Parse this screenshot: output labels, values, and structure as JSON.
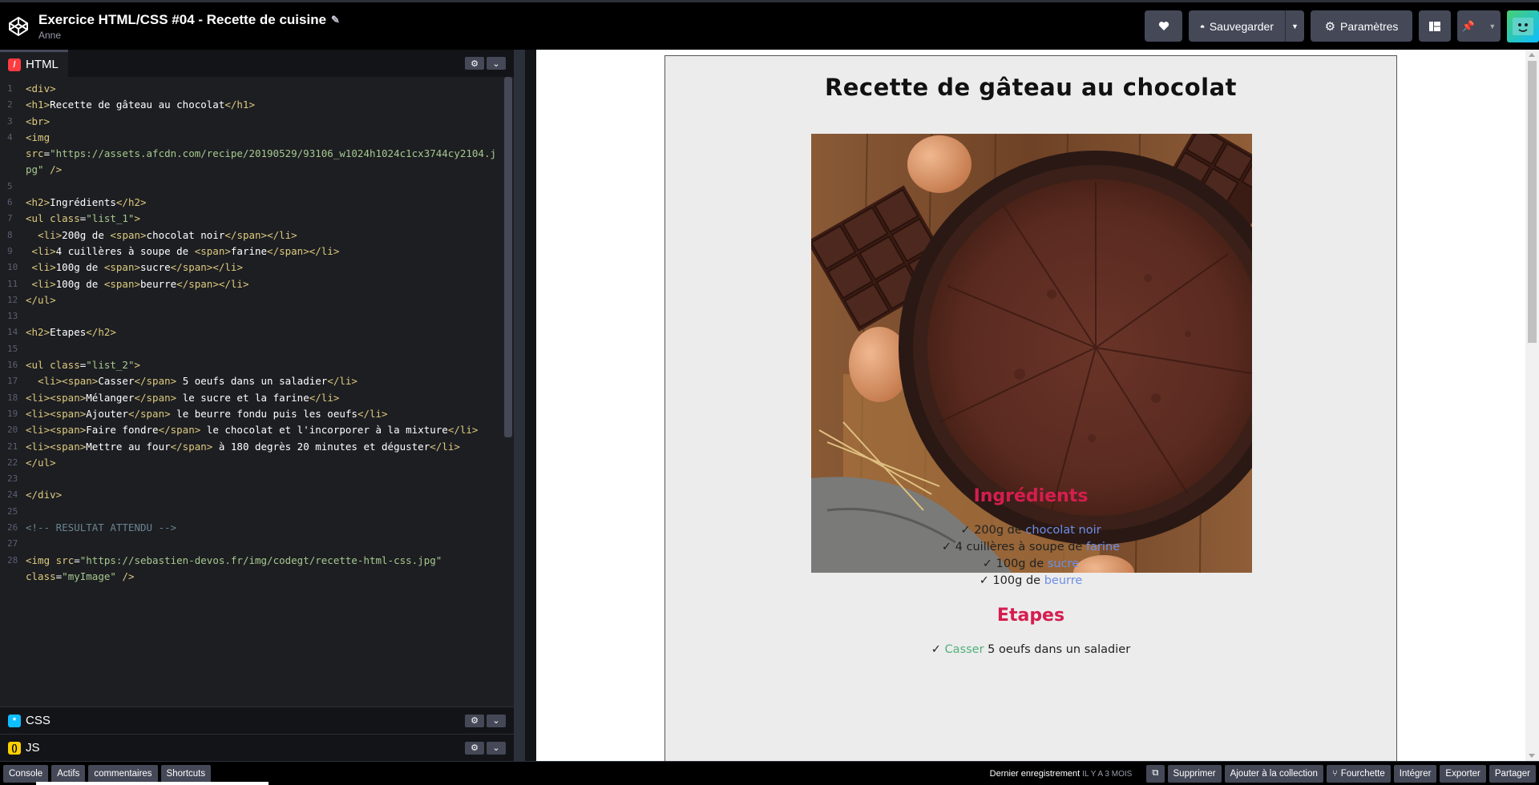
{
  "header": {
    "title": "Exercice HTML/CSS #04 - Recette de cuisine",
    "author": "Anne",
    "save_label": "Sauvegarder",
    "settings_label": "Paramètres"
  },
  "editor": {
    "html_tab": "HTML",
    "css_tab": "CSS",
    "js_tab": "JS",
    "line_numbers": [
      "1",
      "2",
      "3",
      "4",
      "",
      "",
      "5",
      "6",
      "7",
      "8",
      "9",
      "10",
      "11",
      "12",
      "13",
      "14",
      "15",
      "16",
      "17",
      "18",
      "19",
      "20",
      "21",
      "22",
      "23",
      "24",
      "25",
      "26",
      "27",
      "28",
      ""
    ]
  },
  "preview": {
    "title": "Recette de gâteau au chocolat",
    "ingredients_title": "Ingrédients",
    "ingredients": [
      {
        "pre": "✓ 200g de ",
        "hl": "chocolat noir",
        "post": ""
      },
      {
        "pre": "✓ 4 cuillères à soupe de ",
        "hl": "farine",
        "post": ""
      },
      {
        "pre": "✓ 100g de ",
        "hl": "sucre",
        "post": ""
      },
      {
        "pre": "✓ 100g de ",
        "hl": "beurre",
        "post": ""
      }
    ],
    "steps_title": "Etapes",
    "steps": [
      {
        "pre": "✓ ",
        "hl": "Casser",
        "post": " 5 oeufs dans un saladier"
      }
    ]
  },
  "footer": {
    "console": "Console",
    "assets": "Actifs",
    "comments": "commentaires",
    "shortcuts": "Shortcuts",
    "last_saved": "Dernier enregistrement",
    "last_saved_time": "IL Y A 3 MOIS",
    "delete": "Supprimer",
    "add_collection": "Ajouter à la collection",
    "fork": "Fourchette",
    "embed": "Intégrer",
    "export": "Exporter",
    "share": "Partager"
  },
  "colors": {
    "accent_red": "#d61d4f",
    "accent_blue": "#6c8fe6",
    "accent_green": "#52b07c"
  }
}
